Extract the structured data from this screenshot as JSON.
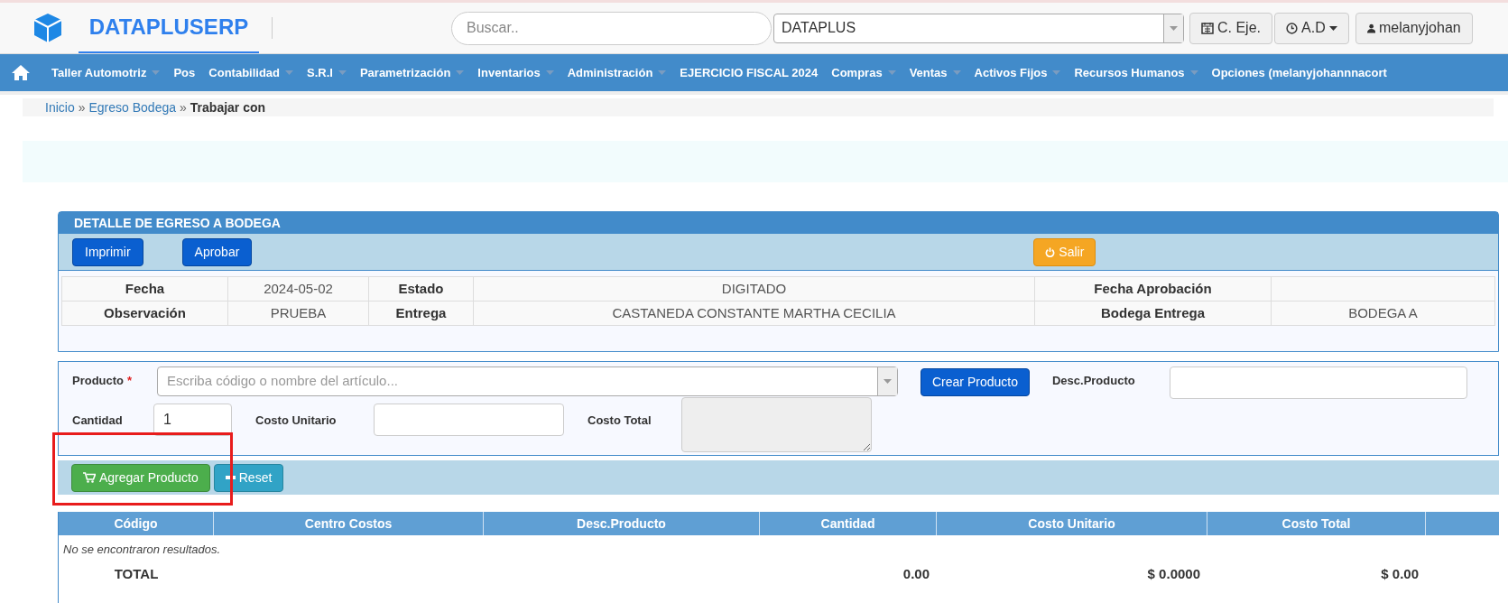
{
  "header": {
    "brand": "DATAPLUSERP",
    "search": {
      "placeholder": "Buscar.."
    },
    "company_select": {
      "value": "DATAPLUS"
    },
    "buttons": [
      {
        "kind": "calendar",
        "label": "C. Eje."
      },
      {
        "kind": "clock",
        "label": "A.D"
      },
      {
        "kind": "user",
        "label": "melanyjohan"
      }
    ]
  },
  "nav": [
    {
      "label": "Taller Automotriz",
      "dropdown": true
    },
    {
      "label": "Pos",
      "dropdown": false
    },
    {
      "label": "Contabilidad",
      "dropdown": true
    },
    {
      "label": "S.R.I",
      "dropdown": true
    },
    {
      "label": "Parametrización",
      "dropdown": true
    },
    {
      "label": "Inventarios",
      "dropdown": true
    },
    {
      "label": "Administración",
      "dropdown": true
    },
    {
      "label": "EJERCICIO FISCAL 2024",
      "dropdown": false
    },
    {
      "label": "Compras",
      "dropdown": true
    },
    {
      "label": "Ventas",
      "dropdown": true
    },
    {
      "label": "Activos Fijos",
      "dropdown": true
    },
    {
      "label": "Recursos Humanos",
      "dropdown": true
    },
    {
      "label": "Opciones (melanyjohannnacort",
      "dropdown": false
    }
  ],
  "breadcrumb": {
    "links": [
      "Inicio",
      "Egreso Bodega"
    ],
    "separator": "»",
    "current": "Trabajar con"
  },
  "panel": {
    "title": "DETALLE DE EGRESO A BODEGA",
    "actions": [
      "Imprimir",
      "Aprobar"
    ],
    "exit_button": "Salir",
    "info_rows": [
      [
        "Fecha",
        "2024-05-02",
        "Estado",
        "DIGITADO",
        "Fecha Aprobación",
        null
      ],
      [
        "Observación",
        "PRUEBA",
        "Entrega",
        "CASTANEDA CONSTANTE MARTHA CECILIA",
        "Bodega Entrega",
        "BODEGA A"
      ]
    ]
  },
  "form": {
    "producto": {
      "label": "Producto",
      "required_mark": "*",
      "placeholder": "Escriba código o nombre del artículo..."
    },
    "create_button": "Crear Producto",
    "desc_label": "Desc.Producto",
    "cantidad": {
      "label": "Cantidad",
      "value": "1"
    },
    "costo_unitario_label": "Costo Unitario",
    "costo_total_label": "Costo Total",
    "add_button": "Agregar Producto",
    "reset_button": "Reset"
  },
  "table": {
    "columns": [
      "Código",
      "Centro Costos",
      "Desc.Producto",
      "Cantidad",
      "Costo Unitario",
      "Costo Total"
    ],
    "empty_message": "No se encontraron resultados.",
    "total_label": "TOTAL",
    "totals": [
      "0.00",
      "$ 0.0000",
      "$ 0.00"
    ]
  }
}
